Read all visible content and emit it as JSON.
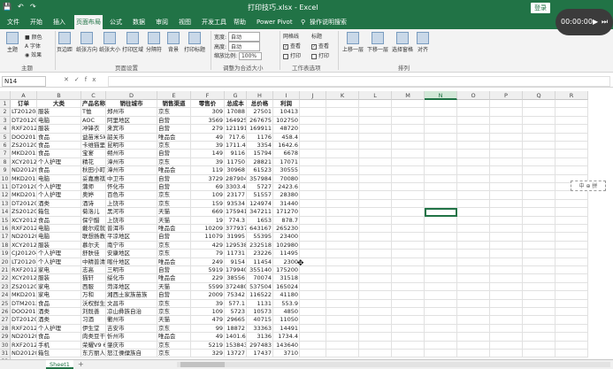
{
  "titlebar": {
    "title": "打印技巧.xlsx - Excel",
    "login": "登录",
    "undo": "↶",
    "redo": "↷"
  },
  "tabs": [
    "文件",
    "开始",
    "插入",
    "页面布局",
    "公式",
    "数据",
    "审阅",
    "视图",
    "开发工具",
    "帮助",
    "Power Pivot",
    "操作说明搜索"
  ],
  "active_tab": "页面布局",
  "ribbon": {
    "themes": {
      "label": "主题",
      "colors": "颜色",
      "fonts": "字体",
      "effects": "效果",
      "group": "主题"
    },
    "page_setup": {
      "buttons": [
        "页边距",
        "纸张方向",
        "纸张大小",
        "打印区域",
        "分隔符",
        "背景",
        "打印标题"
      ],
      "group": "页面设置"
    },
    "scale": {
      "width_label": "宽度:",
      "width_value": "自动",
      "height_label": "高度:",
      "height_value": "自动",
      "scale_label": "缩放比例:",
      "scale_value": "100%",
      "group": "调整为合适大小"
    },
    "sheet_options": {
      "gridlines": "网格线",
      "headings": "标题",
      "view": "查看",
      "print": "打印",
      "group": "工作表选项"
    },
    "arrange": {
      "buttons": [
        "上移一层",
        "下移一层",
        "选择窗格",
        "对齐"
      ],
      "group": "排列"
    }
  },
  "formula_bar": {
    "namebox": "N14",
    "fx": "fx",
    "value": ""
  },
  "columns": [
    "A",
    "B",
    "C",
    "D",
    "E",
    "F",
    "G",
    "H",
    "I",
    "J",
    "K",
    "L",
    "M",
    "N",
    "O",
    "P",
    "Q",
    "R"
  ],
  "selected_column": "N",
  "header_row": [
    "订单",
    "大类",
    "产品名称",
    "销往城市",
    "销售渠道",
    "零售价",
    "总成本",
    "总价格",
    "利润"
  ],
  "rows": [
    [
      "LT201204002",
      "服装",
      "T恤",
      "郑州市",
      "京东",
      "309",
      "17088",
      "27501",
      "10413"
    ],
    [
      "DT201204019",
      "电脑",
      "AOC",
      "阿里地区",
      "自营",
      "3569",
      "164925",
      "267675",
      "102750"
    ],
    [
      "RXF201204020",
      "服装",
      "冲锋衣",
      "来宾市",
      "自营",
      "279",
      "121191",
      "169911",
      "48720"
    ],
    [
      "DOO201204013",
      "食品",
      "益苗米5kg",
      "韶关市",
      "唯品会",
      "49",
      "717.6",
      "1176",
      "458.4"
    ],
    [
      "ZS201204020",
      "食品",
      "卡维猫里",
      "昆明市",
      "京东",
      "39",
      "1711.4",
      "3354",
      "1642.6"
    ],
    [
      "MKD201204003",
      "食品",
      "宝宴",
      "朔州市",
      "自营",
      "149",
      "9116",
      "15794",
      "6678"
    ],
    [
      "XCY201204009",
      "个人护理",
      "精花",
      "漳州市",
      "京东",
      "39",
      "11750",
      "28821",
      "17071"
    ],
    [
      "ND201204034",
      "食品",
      "秋田小町米5kg",
      "漳州市",
      "唯品会",
      "119",
      "30968",
      "61523",
      "30555"
    ],
    [
      "MKD201204028",
      "电脑",
      "妥嘉惠祺SQX4650",
      "中卫市",
      "自营",
      "3729",
      "287904",
      "357984",
      "70080"
    ],
    [
      "DT201204017",
      "个人护理",
      "蒲师",
      "怀化市",
      "自营",
      "69",
      "3303.4",
      "5727",
      "2423.6"
    ],
    [
      "MKD201204011",
      "个人护理",
      "奥婷",
      "百色市",
      "京东",
      "109",
      "23177",
      "51557",
      "28380"
    ],
    [
      "DT201204031",
      "酒类",
      "酒诗",
      "上饶市",
      "京东",
      "159",
      "93534",
      "124974",
      "31440"
    ],
    [
      "ZS201204015",
      "箱包",
      "菊洛儿",
      "黑河市",
      "天猫",
      "669",
      "175941",
      "347211",
      "171270"
    ],
    [
      "XCY201204005",
      "食品",
      "保宁醋",
      "上饶市",
      "天猫",
      "19",
      "774.3",
      "1653",
      "878.7"
    ],
    [
      "RXF201204033",
      "电脑",
      "戴尔成就AIO",
      "普洱市",
      "唯品会",
      "10209",
      "377937",
      "643167",
      "265230"
    ],
    [
      "ND201204003",
      "电脑",
      "联想扬教者R720",
      "平凉地区",
      "自营",
      "11079",
      "31995",
      "55395",
      "23400"
    ],
    [
      "XCY201204010",
      "服装",
      "慕尔夫",
      "南宁市",
      "京东",
      "429",
      "129538",
      "232518",
      "102980"
    ],
    [
      "CJ201204035",
      "个人护理",
      "舒肤佳",
      "安康地区",
      "京东",
      "79",
      "11731",
      "23226",
      "11495"
    ],
    [
      "LT201204017",
      "个人护理",
      "中精普清",
      "喀什地区",
      "唯品会",
      "249",
      "9154",
      "11454",
      "2300"
    ],
    [
      "RXF201204024",
      "家电",
      "志高",
      "三明市",
      "自营",
      "5919",
      "179940",
      "355140",
      "175200"
    ],
    [
      "XCY201204009",
      "服装",
      "猫轩",
      "绥化市",
      "唯品会",
      "229",
      "38556",
      "70074",
      "31518"
    ],
    [
      "ZS201204021",
      "家电",
      "西服",
      "菏泽地区",
      "天猫",
      "5599",
      "372480",
      "537504",
      "165024"
    ],
    [
      "MKD201204006",
      "家电",
      "万和",
      "湘西土家族苗族",
      "自营",
      "2009",
      "75342",
      "116522",
      "41180"
    ],
    [
      "DTM201204004",
      "食品",
      "沃权鲜生抽",
      "文昌市",
      "京东",
      "39",
      "577.1",
      "1131",
      "553.9"
    ],
    [
      "DOO201204033",
      "酒类",
      "刘既善",
      "凉山彝族自治",
      "京东",
      "109",
      "5723",
      "10573",
      "4850"
    ],
    [
      "DT201204014",
      "酒类",
      "习酒",
      "衢州市",
      "天猫",
      "479",
      "29665",
      "40715",
      "11050"
    ],
    [
      "RXF201204037",
      "个人护理",
      "伊生堂",
      "吉安市",
      "京东",
      "99",
      "18872",
      "33363",
      "14491"
    ],
    [
      "ND201204009",
      "食品",
      "肉类豆干",
      "忻州市",
      "唯品会",
      "49",
      "1401.6",
      "3136",
      "1734.4"
    ],
    [
      "RXF201204019",
      "手机",
      "荣耀V9 6G",
      "肇庆市",
      "京东",
      "5219",
      "153843",
      "297483",
      "143640"
    ],
    [
      "ND201204015",
      "箱包",
      "东方丽人",
      "怒江傈僳族自",
      "京东",
      "329",
      "13727",
      "17437",
      "3710"
    ]
  ],
  "row_numbers_visible": [
    "1",
    "2",
    "3",
    "4",
    "5",
    "6",
    "7",
    "8",
    "9",
    "10",
    "11",
    "12",
    "13",
    "14",
    "15",
    "16",
    "17",
    "18",
    "19",
    "20",
    "21",
    "22",
    "23",
    "24",
    "25",
    "26",
    "27",
    "28",
    "29",
    "30",
    "31",
    "32"
  ],
  "sheet_tab": "Sheet1",
  "add_sheet": "+",
  "timer": {
    "time": "00:00:00",
    "play": "▶",
    "forward": "⏭"
  },
  "widget": {
    "text": "中 ⊕ 拼"
  }
}
